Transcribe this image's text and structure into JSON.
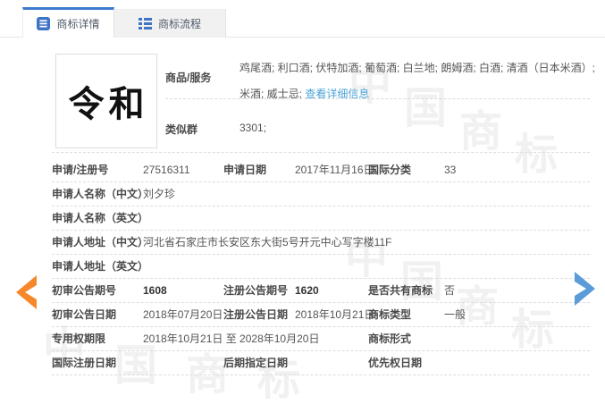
{
  "tabs": {
    "detail": {
      "label": "商标详情"
    },
    "process": {
      "label": "商标流程"
    }
  },
  "trademark": {
    "image_text": "令和"
  },
  "top": {
    "goods_label": "商品/服务",
    "goods_value": "鸡尾酒; 利口酒; 伏特加酒; 葡萄酒; 白兰地; 朗姆酒; 白酒; 清酒（日本米酒）; 米酒; 威士忌;",
    "goods_link": "查看详细信息",
    "similar_group_label": "类似群",
    "similar_group_value": "3301;"
  },
  "rows": [
    {
      "cells": [
        {
          "label": "申请/注册号",
          "value": "27516311"
        },
        {
          "label": "申请日期",
          "value": "2017年11月16日"
        },
        {
          "label": "国际分类",
          "value": "33"
        }
      ]
    },
    {
      "cells": [
        {
          "label": "申请人名称（中文）",
          "value": "刘夕珍"
        }
      ]
    },
    {
      "cells": [
        {
          "label": "申请人名称（英文）",
          "value": ""
        }
      ]
    },
    {
      "cells": [
        {
          "label": "申请人地址（中文）",
          "value": "河北省石家庄市长安区东大街5号开元中心写字楼11F"
        }
      ]
    },
    {
      "cells": [
        {
          "label": "申请人地址（英文）",
          "value": ""
        }
      ]
    },
    {
      "cells": [
        {
          "label": "初审公告期号",
          "value": "1608"
        },
        {
          "label": "注册公告期号",
          "value": "1620"
        },
        {
          "label": "是否共有商标",
          "value": "否"
        }
      ]
    },
    {
      "cells": [
        {
          "label": "初审公告日期",
          "value": "2018年07月20日"
        },
        {
          "label": "注册公告日期",
          "value": "2018年10月21日"
        },
        {
          "label": "商标类型",
          "value": "一般"
        }
      ]
    },
    {
      "cells": [
        {
          "label": "专用权期限",
          "value": "2018年10月21日 至 2028年10月20日"
        },
        {
          "label": "商标形式",
          "value": ""
        }
      ]
    },
    {
      "cells": [
        {
          "label": "国际注册日期",
          "value": ""
        },
        {
          "label": "后期指定日期",
          "value": ""
        },
        {
          "label": "优先权日期",
          "value": ""
        }
      ]
    }
  ],
  "watermark": {
    "chars": [
      "中",
      "国",
      "商",
      "标"
    ]
  },
  "colors": {
    "tab_accent": "#3e7ad2",
    "link_blue": "#4da3d8",
    "arrow_orange": "#f6882b",
    "arrow_blue": "#5b9bd8"
  }
}
